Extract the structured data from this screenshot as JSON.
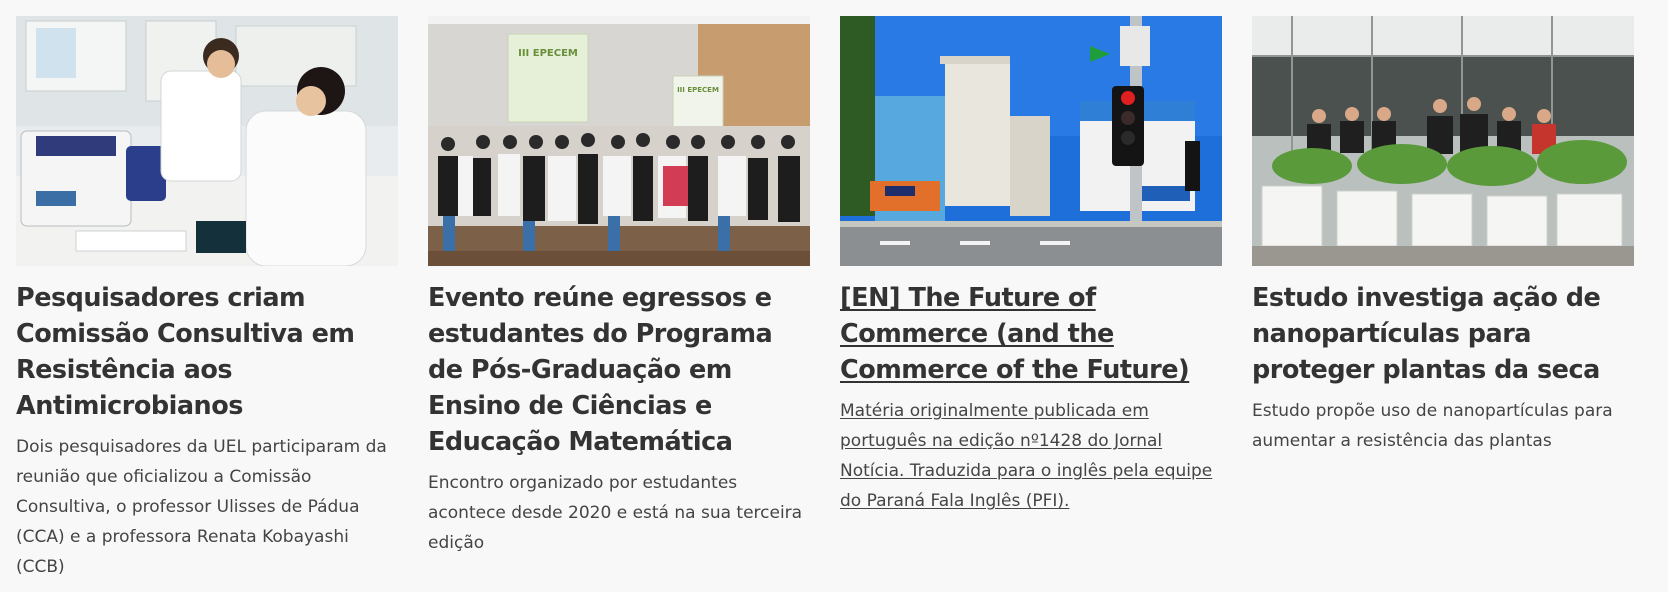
{
  "articles": [
    {
      "image_alt": "Pesquisadores em laboratório",
      "title": "Pesquisadores criam Comissão Consultiva em Resistência aos Antimicrobianos",
      "excerpt": "Dois pesquisadores da UEL participaram da reunião que oficializou a Comissão Consultiva, o professor Ulisses de Pádua (CCA) e a professora Renata Kobayashi (CCB)"
    },
    {
      "image_alt": "Foto do grupo no III EPECEM",
      "banner_text": "III EPECEM",
      "title": "Evento reúne egressos e estudantes do Programa de Pós-Graduação em Ensino de Ciências e Educação Matemática",
      "excerpt": "Encontro organizado por estudantes acontece desde 2020 e está na sua terceira edição"
    },
    {
      "image_alt": "Rua e semáforo em Londrina",
      "title": "[EN] The Future of Commerce (and the Commerce of the Future)",
      "excerpt": "Matéria originalmente publicada em português na edição nº1428 do Jornal Notícia. Traduzida para o inglês pela equipe do Paraná Fala Inglês (PFI)."
    },
    {
      "image_alt": "Equipe de pesquisa em estufa",
      "title": "Estudo investiga ação de nanopartículas para proteger plantas da seca",
      "excerpt": "Estudo propõe uso de nanopartículas para aumentar a resistência das plantas"
    }
  ]
}
